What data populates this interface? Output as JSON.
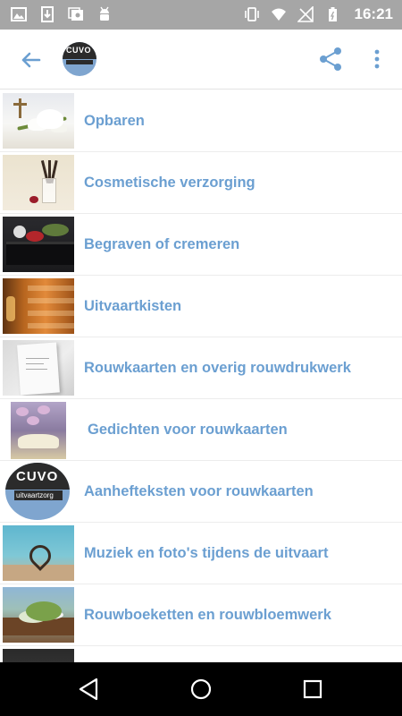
{
  "status_bar": {
    "time": "16:21",
    "left_icons": [
      "image-icon",
      "download-icon",
      "photo-stack-icon",
      "android-icon"
    ],
    "right_icons": [
      "vibrate-icon",
      "wifi-icon",
      "no-signal-icon",
      "battery-icon"
    ]
  },
  "app_bar": {
    "back_icon": "arrow-left-icon",
    "logo_text": "CUVO",
    "share_icon": "share-icon",
    "more_icon": "more-vert-icon",
    "accent_color": "#6b9fd1"
  },
  "menu_items": [
    {
      "label": "Opbaren",
      "thumb": "lily-photo"
    },
    {
      "label": "Cosmetische verzorging",
      "thumb": "makeup-brushes-photo"
    },
    {
      "label": "Begraven of cremeren",
      "thumb": "coffin-roses-photo"
    },
    {
      "label": "Uitvaartkisten",
      "thumb": "wooden-coffins-photo"
    },
    {
      "label": "Rouwkaarten en overig rouwdrukwerk",
      "thumb": "mourning-card-photo"
    },
    {
      "label": "Gedichten voor rouwkaarten",
      "thumb": "book-flowers-photo"
    },
    {
      "label": "Aanhefteksten voor rouwkaarten",
      "thumb": "cuvo-logo"
    },
    {
      "label": "Muziek en foto's tijdens de uitvaart",
      "thumb": "sand-heart-photo"
    },
    {
      "label": "Rouwboeketten en rouwbloemwerk",
      "thumb": "coffin-bouquet-photo"
    }
  ],
  "cuvo_logo": {
    "title": "CUVO",
    "subtitle": "uitvaartzorg"
  },
  "nav_bar": {
    "back_icon": "nav-back-icon",
    "home_icon": "nav-home-icon",
    "recents_icon": "nav-recents-icon"
  }
}
